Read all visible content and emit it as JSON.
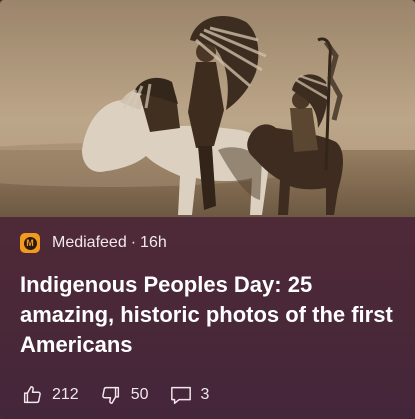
{
  "article": {
    "image_alt": "Sepia historic photograph of Native American riders in feathered headdresses on horseback",
    "source_logo_letter": "M",
    "source": "Mediafeed",
    "separator": "·",
    "age": "16h",
    "headline": "Indigenous Peoples Day: 25 amazing, historic photos of the first Americans"
  },
  "actions": {
    "like_count": "212",
    "dislike_count": "50",
    "comment_count": "3"
  },
  "colors": {
    "card_background": "#4d2937",
    "source_logo": "#f29a1f",
    "headline_text": "#ffffff"
  },
  "icons": [
    "thumbs-up-icon",
    "thumbs-down-icon",
    "comment-icon"
  ]
}
